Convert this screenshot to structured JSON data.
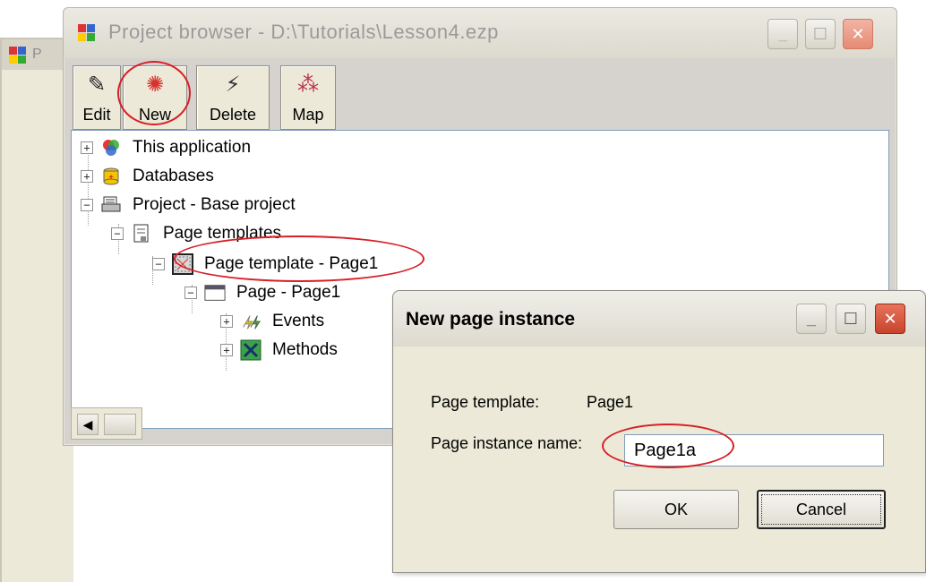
{
  "background_window": {
    "title": "P"
  },
  "project_browser": {
    "title": "Project browser - D:\\Tutorials\\Lesson4.ezp",
    "toolbar": [
      {
        "label": "Edit",
        "icon": "edit-icon"
      },
      {
        "label": "New",
        "icon": "new-icon"
      },
      {
        "label": "Delete",
        "icon": "delete-icon"
      },
      {
        "label": "Map",
        "icon": "map-icon"
      }
    ],
    "tree": [
      {
        "label": "This application",
        "expander": "+",
        "icon": "application-icon"
      },
      {
        "label": "Databases",
        "expander": "+",
        "icon": "database-icon"
      },
      {
        "label": "Project - Base project",
        "expander": "−",
        "icon": "project-icon"
      },
      {
        "label": "Page templates",
        "expander": "−",
        "icon": "page-templates-icon"
      },
      {
        "label": "Page template - Page1",
        "expander": "−",
        "icon": "page-template-icon"
      },
      {
        "label": "Page - Page1",
        "expander": "−",
        "icon": "page-icon"
      },
      {
        "label": "Events",
        "expander": "+",
        "icon": "events-icon"
      },
      {
        "label": "Methods",
        "expander": "+",
        "icon": "methods-icon"
      }
    ]
  },
  "dialog": {
    "title": "New page instance",
    "template_label": "Page template:",
    "template_value": "Page1",
    "instance_label": "Page instance name:",
    "instance_value": "Page1a",
    "ok_label": "OK",
    "cancel_label": "Cancel"
  },
  "colors": {
    "highlight_ellipse": "#d71f26",
    "close_button": "#e58a75"
  }
}
